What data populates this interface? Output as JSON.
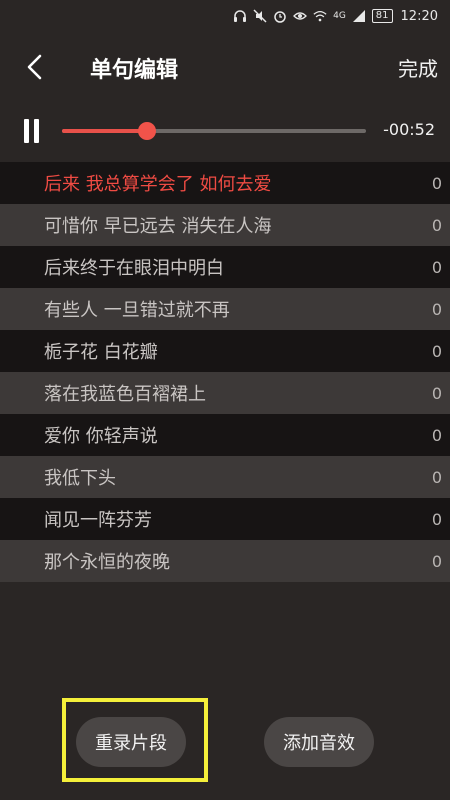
{
  "status_bar": {
    "battery": "81",
    "network": "4G",
    "time": "12:20"
  },
  "header": {
    "title": "单句编辑",
    "done_label": "完成"
  },
  "player": {
    "progress": 0.28,
    "remaining_time": "-00:52"
  },
  "lyrics": [
    {
      "text": "后来 我总算学会了 如何去爱",
      "count": "0",
      "active": true
    },
    {
      "text": "可惜你 早已远去 消失在人海",
      "count": "0"
    },
    {
      "text": "后来终于在眼泪中明白",
      "count": "0"
    },
    {
      "text": "有些人 一旦错过就不再",
      "count": "0"
    },
    {
      "text": "栀子花 白花瓣",
      "count": "0"
    },
    {
      "text": "落在我蓝色百褶裙上",
      "count": "0"
    },
    {
      "text": "爱你 你轻声说",
      "count": "0"
    },
    {
      "text": "我低下头",
      "count": "0"
    },
    {
      "text": "闻见一阵芬芳",
      "count": "0"
    },
    {
      "text": "那个永恒的夜晚",
      "count": "0"
    }
  ],
  "actions": {
    "rerecord_label": "重录片段",
    "add_effect_label": "添加音效"
  },
  "colors": {
    "accent": "#ef4b43",
    "highlight": "#f4ef3a"
  }
}
